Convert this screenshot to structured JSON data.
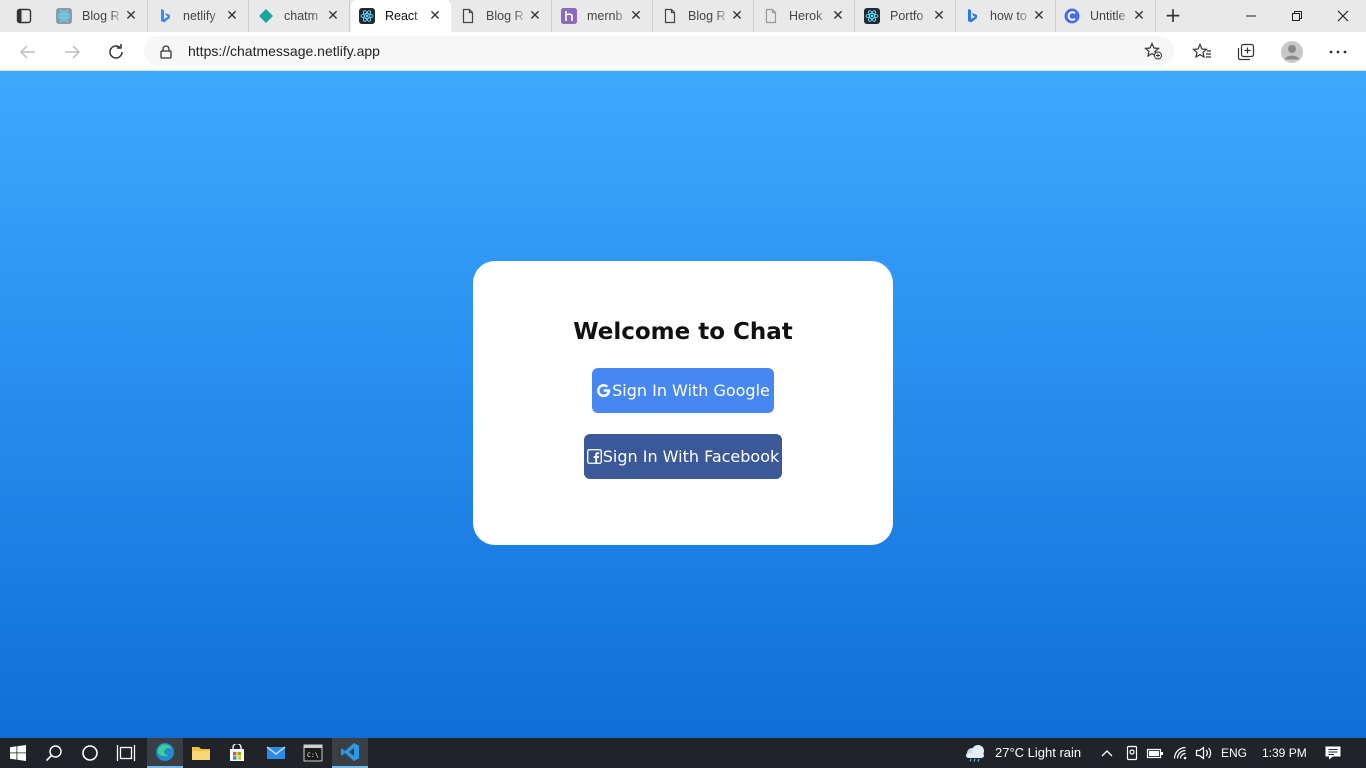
{
  "browser": {
    "tabs": [
      {
        "title": "Blog R",
        "icon": "react-icon",
        "color": "#8a9aa6"
      },
      {
        "title": "netlify",
        "icon": "bing-icon",
        "color": "#3a8fe6"
      },
      {
        "title": "chatm",
        "icon": "netlify-icon",
        "color": "#16a89a"
      },
      {
        "title": "React",
        "icon": "react-icon",
        "color": "#23272f",
        "active": true
      },
      {
        "title": "Blog R",
        "icon": "page-icon",
        "color": "#444444"
      },
      {
        "title": "mernb",
        "icon": "heroku-icon",
        "color": "#8e6bb8"
      },
      {
        "title": "Blog R",
        "icon": "page-icon",
        "color": "#444444"
      },
      {
        "title": "Herok",
        "icon": "page-icon",
        "color": "#999999"
      },
      {
        "title": "Portfo",
        "icon": "react-icon",
        "color": "#23272f"
      },
      {
        "title": "how to",
        "icon": "bing-icon",
        "color": "#2a7be4"
      },
      {
        "title": "Untitle",
        "icon": "codepen-icon",
        "color": "#4b6ee6"
      }
    ],
    "address": {
      "url": "https://chatmessage.netlify.app"
    }
  },
  "page": {
    "heading": "Welcome to Chat",
    "google_button": "Sign In With Google",
    "facebook_button": "Sign In With Facebook",
    "colors": {
      "background_top": "#3ea8fd",
      "background_bottom": "#0f6fd8",
      "google": "#4788f0",
      "facebook": "#3b5998"
    }
  },
  "taskbar": {
    "weather": "27°C  Light rain",
    "language": "ENG",
    "time": "1:39 PM"
  }
}
